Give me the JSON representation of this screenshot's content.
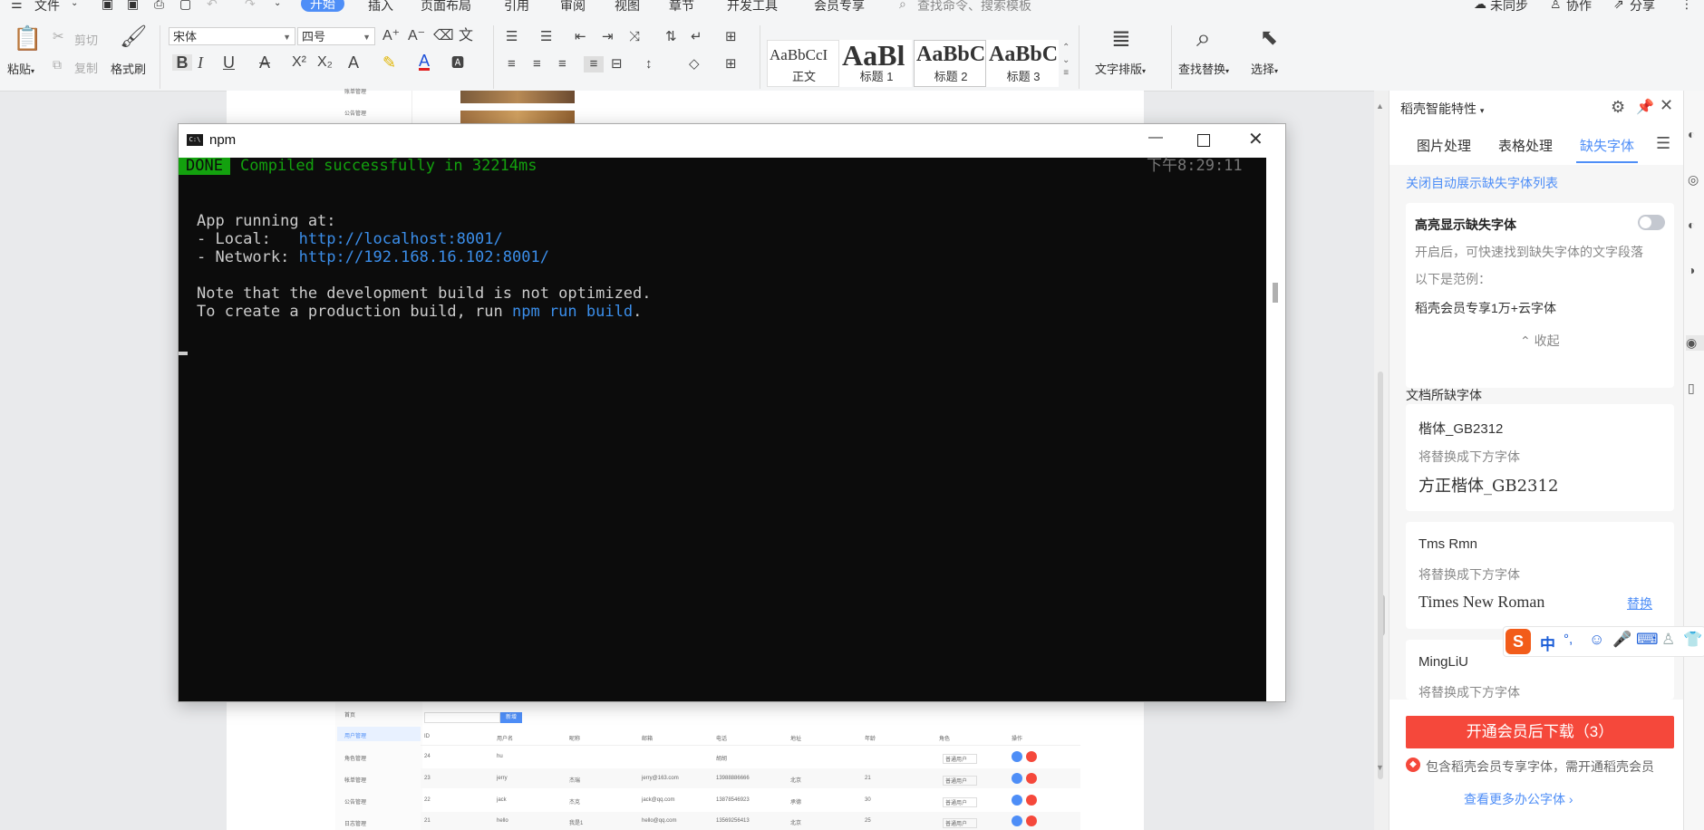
{
  "menubar": {
    "file": "文件",
    "tabs": [
      "开始",
      "插入",
      "页面布局",
      "引用",
      "审阅",
      "视图",
      "章节",
      "开发工具",
      "会员专享"
    ],
    "search_placeholder": "查找命令、搜索模板",
    "unsynced": "未同步",
    "collab": "协作",
    "share": "分享"
  },
  "ribbon": {
    "paste": "粘贴",
    "cut": "剪切",
    "copy": "复制",
    "format_painter": "格式刷",
    "font_name": "宋体",
    "font_size": "四号",
    "styles": [
      {
        "preview": "AaBbCcI",
        "name": "正文"
      },
      {
        "preview": "AaBl",
        "name": "标题 1"
      },
      {
        "preview": "AaBbC",
        "name": "标题 2"
      },
      {
        "preview": "AaBbC",
        "name": "标题 3"
      }
    ],
    "text_layout": "文字排版",
    "find_replace": "查找替换",
    "select": "选择"
  },
  "terminal": {
    "title": "npm",
    "done_badge": "DONE",
    "compiled": "Compiled successfully in 32214ms",
    "time": "下午8:29:11",
    "app_running": "App running at:",
    "local_label": "- Local:   ",
    "local_url": "http://localhost:8001/",
    "network_label": "- Network: ",
    "network_url": "http://192.168.16.102:8001/",
    "note": "Note that the development build is not optimized.",
    "prod_prefix": "To create a production build, run ",
    "prod_cmd": "npm run build",
    "prod_suffix": "."
  },
  "document": {
    "top_sidebar_items": [
      "账单管理",
      "公告管理"
    ],
    "sidebar_items": [
      "首页",
      "用户管理",
      "角色管理",
      "帐单管理",
      "公告管理",
      "日志管理"
    ],
    "add_button": "新增",
    "columns": [
      "ID",
      "用户名",
      "昵称",
      "邮箱",
      "电话",
      "地址",
      "年龄",
      "角色",
      "操作"
    ],
    "rows": [
      {
        "id": "24",
        "user": "hu",
        "nick": "",
        "email": "",
        "phone": "胡胡",
        "addr": "",
        "age": "",
        "role": "普通用户"
      },
      {
        "id": "23",
        "user": "jerry",
        "nick": "杰瑞",
        "email": "jerry@163.com",
        "phone": "13988886666",
        "addr": "北京",
        "age": "21",
        "role": "普通用户"
      },
      {
        "id": "22",
        "user": "jack",
        "nick": "杰克",
        "email": "jack@qq.com",
        "phone": "13878546923",
        "addr": "承德",
        "age": "30",
        "role": "普通用户"
      },
      {
        "id": "21",
        "user": "hello",
        "nick": "我是1",
        "email": "hello@qq.com",
        "phone": "13569256413",
        "addr": "北京",
        "age": "25",
        "role": "普通用户"
      }
    ]
  },
  "pane": {
    "title": "稻壳智能特性",
    "tabs": [
      "图片处理",
      "表格处理",
      "缺失字体"
    ],
    "close_auto_link": "关闭自动展示缺失字体列表",
    "highlight_title": "高亮显示缺失字体",
    "highlight_desc": "开启后，可快速找到缺失字体的文字段落",
    "example_label": "以下是范例：",
    "example_text": "稻壳会员专享1万+云字体",
    "collapse": "收起",
    "doc_missing": "文档所缺字体",
    "fonts": [
      {
        "name": "楷体_GB2312",
        "hint": "将替换成下方字体",
        "replacement": "方正楷体_GB2312",
        "action": ""
      },
      {
        "name": "Tms Rmn",
        "hint": "将替换成下方字体",
        "replacement": "Times New Roman",
        "action": "替换"
      },
      {
        "name": "MingLiU",
        "hint": "将替换成下方字体",
        "replacement": "",
        "action": ""
      }
    ],
    "download_button": "开通会员后下载（3）",
    "member_note": "包含稻壳会员专享字体，需开通稻壳会员",
    "more_fonts": "查看更多办公字体"
  },
  "ime": {
    "lang": "中",
    "punct": "°,"
  },
  "colors": {
    "accent": "#4e8ef7",
    "download_button": "#f5483b",
    "done_badge": "#13a10e",
    "terminal_bg": "#0c0c0c",
    "link": "#3b8eea"
  }
}
